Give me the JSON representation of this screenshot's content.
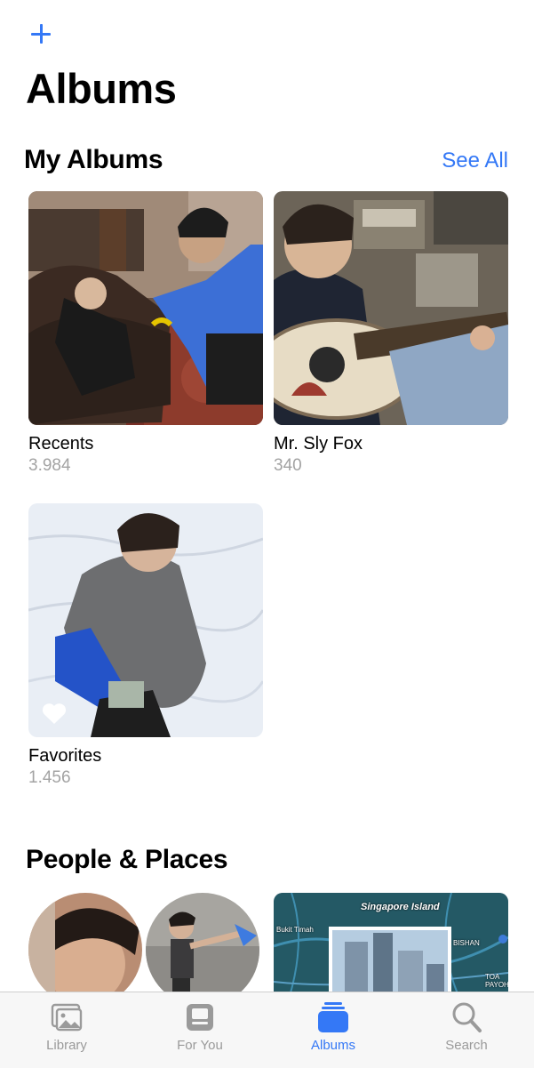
{
  "header": {
    "add_icon": "plus-icon",
    "title": "Albums"
  },
  "my_albums": {
    "heading": "My Albums",
    "see_all": "See All",
    "albums": [
      {
        "name": "Recents",
        "count": "3.984"
      },
      {
        "name": "Mr. Sly Fox",
        "count": "340"
      },
      {
        "name": "Favorites",
        "count": "1.456",
        "badge_icon": "heart-icon"
      }
    ]
  },
  "people_places": {
    "heading": "People & Places",
    "map_labels": [
      "Singapore Island",
      "Bukit Timah",
      "BISHAN",
      "TOA PAYOH"
    ]
  },
  "tabbar": {
    "tabs": [
      {
        "label": "Library",
        "icon": "photo-library-icon",
        "active": false
      },
      {
        "label": "For You",
        "icon": "for-you-icon",
        "active": false
      },
      {
        "label": "Albums",
        "icon": "albums-icon",
        "active": true
      },
      {
        "label": "Search",
        "icon": "search-icon",
        "active": false
      }
    ]
  },
  "colors": {
    "accent": "#3478f6",
    "secondary_text": "#a3a3a3",
    "tab_inactive": "#9a9a9a"
  }
}
